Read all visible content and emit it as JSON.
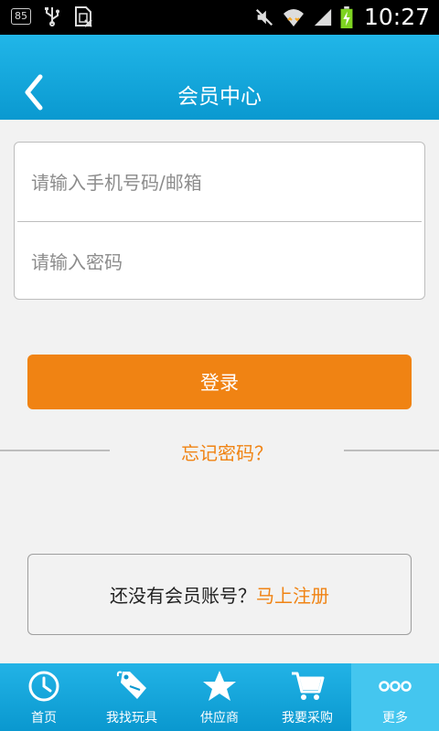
{
  "status_bar": {
    "battery_badge": "85",
    "time": "10:27"
  },
  "header": {
    "title": "会员中心"
  },
  "form": {
    "phone_placeholder": "请输入手机号码/邮箱",
    "password_placeholder": "请输入密码"
  },
  "login_label": "登录",
  "forgot_label": "忘记密码？",
  "register": {
    "prompt": "还没有会员账号？",
    "link": "马上注册"
  },
  "bottom_nav": {
    "items": [
      {
        "label": "首页",
        "icon": "clock-icon"
      },
      {
        "label": "我找玩具",
        "icon": "sale-tag-icon"
      },
      {
        "label": "供应商",
        "icon": "star-icon"
      },
      {
        "label": "我要采购",
        "icon": "cart-icon"
      },
      {
        "label": "更多",
        "icon": "more-dots-icon"
      }
    ],
    "active_index": 4
  },
  "colors": {
    "accent": "#f08313",
    "header_blue": "#0a99d0"
  }
}
